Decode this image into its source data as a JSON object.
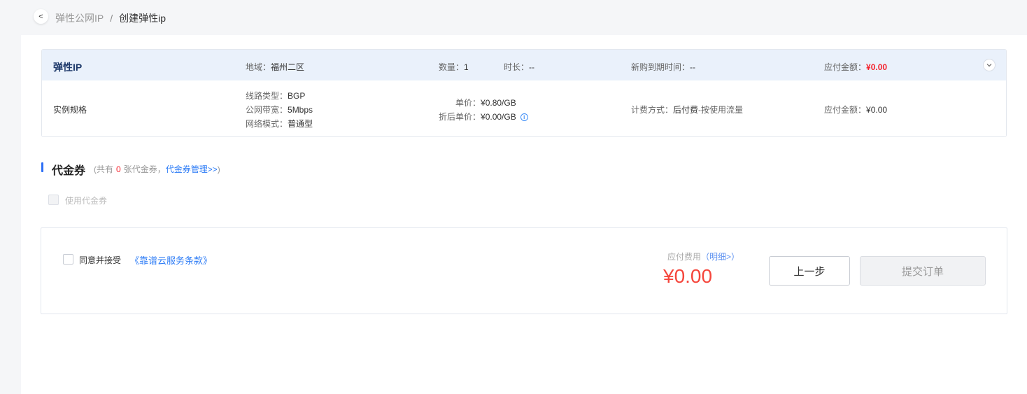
{
  "header": {
    "back_icon": "<",
    "breadcrumb_parent": "弹性公网IP",
    "breadcrumb_sep": "/",
    "breadcrumb_current": "创建弹性ip"
  },
  "order": {
    "title": "弹性IP",
    "region_label": "地域：",
    "region_value": "福州二区",
    "qty_label": "数量：",
    "qty_value": "1",
    "duration_label": "时长：",
    "duration_value": "--",
    "expire_label": "新购到期时间：",
    "expire_value": "--",
    "amount_label": "应付金额：",
    "amount_value": "¥0.00",
    "expand_icon": "chevron-down-icon",
    "spec_label": "实例规格",
    "line_type_label": "线路类型：",
    "line_type_value": "BGP",
    "bandwidth_label": "公网带宽：",
    "bandwidth_value": "5Mbps",
    "network_mode_label": "网络模式：",
    "network_mode_value": "普通型",
    "unit_price_label": "单价：",
    "unit_price_value": "¥0.80/GB",
    "discount_price_label": "折后单价：",
    "discount_price_value": "¥0.00/GB",
    "info_icon": "i",
    "billing_label": "计费方式：",
    "billing_value": "后付费",
    "billing_suffix": "-按使用流量",
    "row_amount_label": "应付金额：",
    "row_amount_value": "¥0.00"
  },
  "voucher": {
    "title": "代金券",
    "note_prefix": "(共有",
    "count": "0",
    "note_mid": "张代金券，",
    "manage_link": "代金券管理>>",
    "note_suffix": ")",
    "use_label": "使用代金券"
  },
  "footer": {
    "agree_label": "同意并接受",
    "terms_link": "《靠谱云服务条款》",
    "fee_label": "应付费用",
    "detail_link": "（明细>）",
    "fee_amount": "¥0.00",
    "prev_button": "上一步",
    "submit_button": "提交订单"
  },
  "colors": {
    "accent": "#2d6ff6",
    "price_red": "#f5222d",
    "header_bg": "#eaf1fb"
  }
}
